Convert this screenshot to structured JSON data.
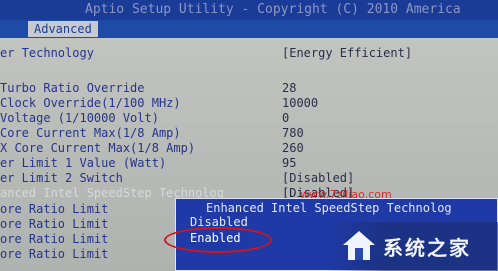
{
  "title": "Aptio Setup Utility - Copyright (C) 2010 America",
  "active_tab": "Advanced",
  "settings": [
    {
      "label": "er Technology",
      "value": "[Energy Efficient]"
    },
    {
      "label": "Turbo Ratio Override",
      "value": "28"
    },
    {
      "label": "Clock Override(1/100 MHz)",
      "value": "10000"
    },
    {
      "label": "Voltage (1/10000 Volt)",
      "value": "0"
    },
    {
      "label": "Core Current Max(1/8 Amp)",
      "value": "780"
    },
    {
      "label": "X Core Current Max(1/8 Amp)",
      "value": "260"
    },
    {
      "label": "er Limit 1 Value (Watt)",
      "value": "95"
    },
    {
      "label": "er Limit 2 Switch",
      "value": "[Disabled]"
    },
    {
      "label": "anced Intel SpeedStep Technolog",
      "value": "[Disabled]"
    },
    {
      "label": "ore Ratio Limit",
      "value": ""
    },
    {
      "label": "ore Ratio Limit",
      "value": ""
    },
    {
      "label": "ore Ratio Limit",
      "value": ""
    },
    {
      "label": "ore Ratio Limit",
      "value": ""
    }
  ],
  "popup": {
    "title": "Enhanced Intel SpeedStep Technolog",
    "options": [
      "Disabled",
      "Enabled"
    ],
    "selected": "Enabled"
  },
  "watermark": "www.7ziliao.com",
  "logo_text": "系统之家",
  "colors": {
    "title_bar": "#1a3b96",
    "popup_bg": "#1f3aa6",
    "highlight_circle": "#d3141a",
    "label_text": "#25348c"
  }
}
